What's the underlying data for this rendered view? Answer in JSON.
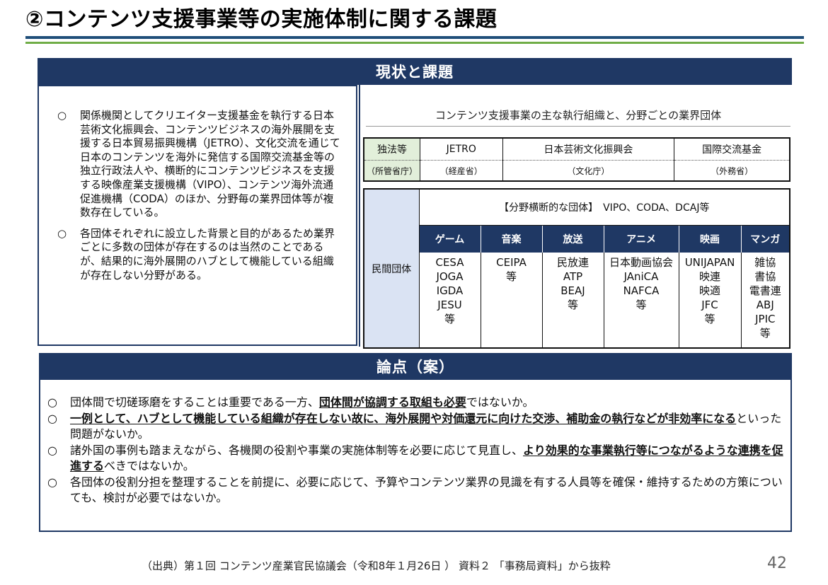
{
  "title": "②コンテンツ支援事業等の実施体制に関する課題",
  "status_section": {
    "header": "現状と課題",
    "bullet_symbol": "○",
    "bullets": [
      "関係機関としてクリエイター支援基金を執行する日本芸術文化振興会、コンテンツビジネスの海外展開を支援する日本貿易振興機構（JETRO）、文化交流を通じて日本のコンテンツを海外に発信する国際交流基金等の独立行政法人や、横断的にコンテンツビジネスを支援する映像産業支援機構（VIPO）、コンテンツ海外流通促進機構（CODA）のほか、分野毎の業界団体等が複数存在している。",
      "各団体それぞれに設立した背景と目的があるため業界ごとに多数の団体が存在するのは当然のことであるが、結果的に海外展開のハブとして機能している組織が存在しない分野がある。"
    ]
  },
  "org_chart": {
    "caption": "コンテンツ支援事業の主な執行組織と、分野ごとの業界団体",
    "iai_label": "独法等",
    "ministry_label": "（所管省庁）",
    "iai": [
      {
        "name": "JETRO",
        "ministry": "（経産省）"
      },
      {
        "name": "日本芸術文化振興会",
        "ministry": "（文化庁）"
      },
      {
        "name": "国際交流基金",
        "ministry": "（外務省）"
      }
    ],
    "private_label": "民間団体",
    "cross_sector": "【分野横断的な団体】　VIPO、CODA、DCAJ等",
    "categories": [
      {
        "name": "ゲーム",
        "orgs": [
          "CESA",
          "JOGA",
          "IGDA",
          "JESU",
          "等"
        ]
      },
      {
        "name": "音楽",
        "orgs": [
          "CEIPA",
          "等"
        ]
      },
      {
        "name": "放送",
        "orgs": [
          "民放連",
          "ATP",
          "BEAJ",
          "等"
        ]
      },
      {
        "name": "アニメ",
        "orgs": [
          "日本動画協会",
          "JAniCA",
          "NAFCA",
          "等"
        ]
      },
      {
        "name": "映画",
        "orgs": [
          "UNIJAPAN",
          "映連",
          "映適",
          "JFC",
          "等"
        ]
      },
      {
        "name": "マンガ",
        "orgs": [
          "雑協",
          "書協",
          "電書連",
          "ABJ",
          "JPIC",
          "等"
        ]
      }
    ]
  },
  "issues_section": {
    "header": "論点（案）",
    "bullet_symbol": "○",
    "items": [
      {
        "pre": "団体間で切磋琢磨をすることは重要である一方、",
        "bold": "団体間が協調する取組も必要",
        "post": "ではないか。"
      },
      {
        "pre": "",
        "bold": "一例として、ハブとして機能している組織が存在しない故に、海外展開や対価還元に向けた交渉、補助金の執行などが非効率になる",
        "post": "といった問題がないか。"
      },
      {
        "pre": "諸外国の事例も踏まえながら、各機関の役割や事業の実施体制等を必要に応じて見直し、",
        "bold": "より効果的な事業執行等につながるような連携を促進する",
        "post": "べきではないか。"
      },
      {
        "pre": "各団体の役割分担を整理することを前提に、必要に応じて、予算やコンテンツ業界の見識を有する人員等を確保・維持するための方策についても、検討が必要ではないか。",
        "bold": "",
        "post": ""
      }
    ]
  },
  "source": "（出典）第１回 コンテンツ産業官民協議会（令和8年１月26日 ） 資料２ 「事務局資料」から抜粋",
  "page_number": "42",
  "colors": {
    "navy": "#1f3864",
    "blue_rule": "#1f4e79",
    "green_rule": "#70ad47",
    "iai_label_bg": "#e2efda",
    "private_label_bg": "#dae3f3"
  }
}
